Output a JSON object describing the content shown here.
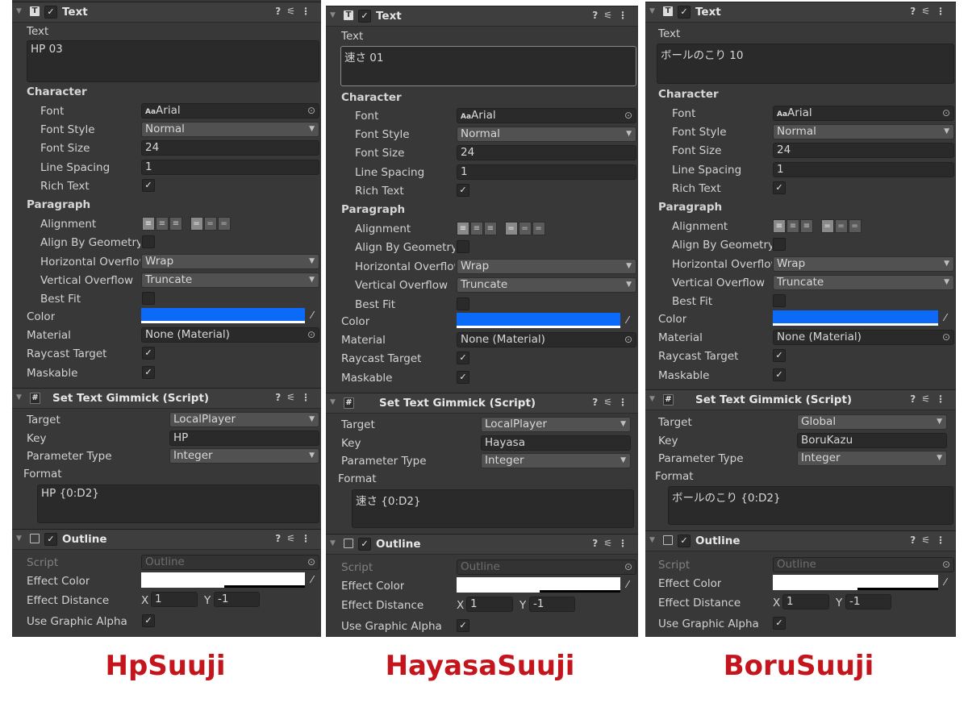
{
  "panels": [
    {
      "text_header": "Text",
      "text_label": "Text",
      "text_value": "HP 03",
      "character": "Character",
      "font_label": "Font",
      "font_value": "Arial",
      "font_prefix": "Aa",
      "font_style_label": "Font Style",
      "font_style_value": "Normal",
      "font_size_label": "Font Size",
      "font_size_value": "24",
      "line_spacing_label": "Line Spacing",
      "line_spacing_value": "1",
      "rich_text_label": "Rich Text",
      "paragraph": "Paragraph",
      "alignment_label": "Alignment",
      "align_geometry_label": "Align By Geometry",
      "h_overflow_label": "Horizontal Overflow",
      "h_overflow_value": "Wrap",
      "v_overflow_label": "Vertical Overflow",
      "v_overflow_value": "Truncate",
      "best_fit_label": "Best Fit",
      "color_label": "Color",
      "color_hex": "#0b6af7",
      "material_label": "Material",
      "material_value": "None (Material)",
      "raycast_label": "Raycast Target",
      "maskable_label": "Maskable",
      "script_header": "Set Text Gimmick (Script)",
      "target_label": "Target",
      "target_value": "LocalPlayer",
      "key_label": "Key",
      "key_value": "HP",
      "param_type_label": "Parameter Type",
      "param_type_value": "Integer",
      "format_label": "Format",
      "format_value": "HP {0:D2}",
      "outline_header": "Outline",
      "script_label": "Script",
      "script_value": "Outline",
      "effect_color_label": "Effect Color",
      "effect_distance_label": "Effect Distance",
      "x_label": "X",
      "x_value": "1",
      "y_label": "Y",
      "y_value": "-1",
      "use_alpha_label": "Use Graphic Alpha",
      "caption": "HpSuuji"
    },
    {
      "text_header": "Text",
      "text_label": "Text",
      "text_value": "速さ 01",
      "character": "Character",
      "font_label": "Font",
      "font_value": "Arial",
      "font_prefix": "Aa",
      "font_style_label": "Font Style",
      "font_style_value": "Normal",
      "font_size_label": "Font Size",
      "font_size_value": "24",
      "line_spacing_label": "Line Spacing",
      "line_spacing_value": "1",
      "rich_text_label": "Rich Text",
      "paragraph": "Paragraph",
      "alignment_label": "Alignment",
      "align_geometry_label": "Align By Geometry",
      "h_overflow_label": "Horizontal Overflow",
      "h_overflow_value": "Wrap",
      "v_overflow_label": "Vertical Overflow",
      "v_overflow_value": "Truncate",
      "best_fit_label": "Best Fit",
      "color_label": "Color",
      "color_hex": "#0b6af7",
      "material_label": "Material",
      "material_value": "None (Material)",
      "raycast_label": "Raycast Target",
      "maskable_label": "Maskable",
      "script_header": "Set Text Gimmick (Script)",
      "target_label": "Target",
      "target_value": "LocalPlayer",
      "key_label": "Key",
      "key_value": "Hayasa",
      "param_type_label": "Parameter Type",
      "param_type_value": "Integer",
      "format_label": "Format",
      "format_value": "速さ {0:D2}",
      "outline_header": "Outline",
      "script_label": "Script",
      "script_value": "Outline",
      "effect_color_label": "Effect Color",
      "effect_distance_label": "Effect Distance",
      "x_label": "X",
      "x_value": "1",
      "y_label": "Y",
      "y_value": "-1",
      "use_alpha_label": "Use Graphic Alpha",
      "caption": "HayasaSuuji"
    },
    {
      "text_header": "Text",
      "text_label": "Text",
      "text_value": "ボールのこり 10",
      "character": "Character",
      "font_label": "Font",
      "font_value": "Arial",
      "font_prefix": "Aa",
      "font_style_label": "Font Style",
      "font_style_value": "Normal",
      "font_size_label": "Font Size",
      "font_size_value": "24",
      "line_spacing_label": "Line Spacing",
      "line_spacing_value": "1",
      "rich_text_label": "Rich Text",
      "paragraph": "Paragraph",
      "alignment_label": "Alignment",
      "align_geometry_label": "Align By Geometry",
      "h_overflow_label": "Horizontal Overflow",
      "h_overflow_value": "Wrap",
      "v_overflow_label": "Vertical Overflow",
      "v_overflow_value": "Truncate",
      "best_fit_label": "Best Fit",
      "color_label": "Color",
      "color_hex": "#0b6af7",
      "material_label": "Material",
      "material_value": "None (Material)",
      "raycast_label": "Raycast Target",
      "maskable_label": "Maskable",
      "script_header": "Set Text Gimmick (Script)",
      "target_label": "Target",
      "target_value": "Global",
      "key_label": "Key",
      "key_value": "BoruKazu",
      "param_type_label": "Parameter Type",
      "param_type_value": "Integer",
      "format_label": "Format",
      "format_value": "ボールのこり {0:D2}",
      "outline_header": "Outline",
      "script_label": "Script",
      "script_value": "Outline",
      "effect_color_label": "Effect Color",
      "effect_distance_label": "Effect Distance",
      "x_label": "X",
      "x_value": "1",
      "y_label": "Y",
      "y_value": "-1",
      "use_alpha_label": "Use Graphic Alpha",
      "caption": "BoruSuuji"
    }
  ],
  "icons": {
    "fold": "triangle-down",
    "text_component": "text-t-icon",
    "script": "script-hash-icon",
    "outline": "outline-box-icon",
    "help": "help-icon",
    "preset": "preset-sliders-icon",
    "menu": "kebab-menu-icon",
    "picker": "eyedropper-icon",
    "object_picker": "object-target-icon"
  },
  "colors": {
    "caption": "#c4141c",
    "inspector_bg": "#383838"
  }
}
